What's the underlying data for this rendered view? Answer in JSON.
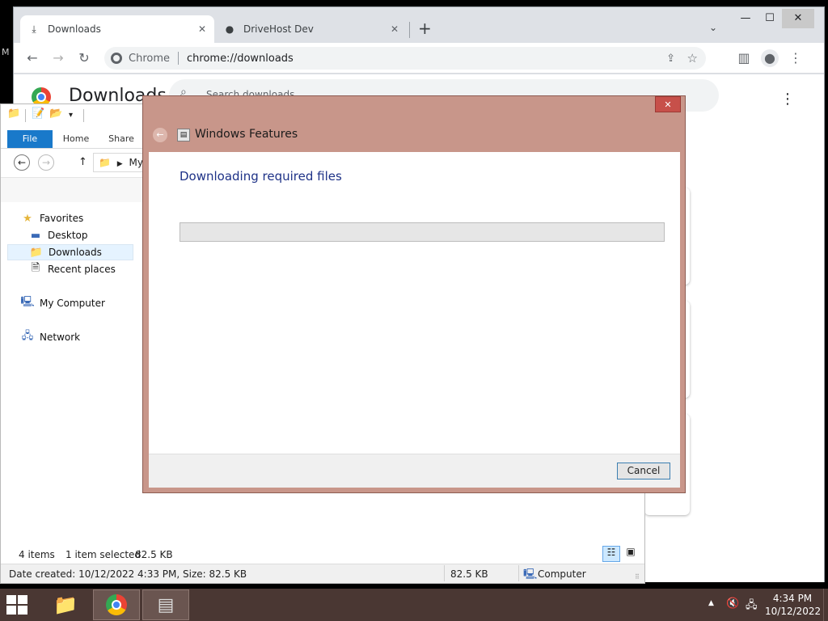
{
  "chrome": {
    "tabs": [
      {
        "label": "Downloads",
        "icon": "download-icon",
        "active": true
      },
      {
        "label": "DriveHost Dev",
        "icon": "globe-icon",
        "active": false
      }
    ],
    "omnibox": {
      "site_label": "Chrome",
      "url": "chrome://downloads"
    },
    "page_title": "Downloads",
    "search_placeholder": "Search downloads"
  },
  "explorer": {
    "ribbon_tabs": [
      "File",
      "Home",
      "Share"
    ],
    "address_crumb": "My",
    "nav": {
      "favorites": "Favorites",
      "desktop": "Desktop",
      "downloads": "Downloads",
      "recent": "Recent places",
      "computer": "My Computer",
      "network": "Network"
    },
    "status": {
      "items": "4 items",
      "selected": "1 item selected",
      "size": "82.5 KB"
    },
    "details_bar": {
      "info": "Date created: 10/12/2022 4:33 PM, Size: 82.5 KB",
      "size": "82.5 KB",
      "location": "Computer"
    }
  },
  "dialog": {
    "title": "Windows Features",
    "heading": "Downloading required files",
    "progress": 0,
    "cancel_label": "Cancel",
    "close_label": "✕"
  },
  "taskbar": {
    "time": "4:34 PM",
    "date": "10/12/2022"
  },
  "colors": {
    "dialog_frame": "#c8968a",
    "heading": "#1e3287",
    "taskbar": "#4a3733",
    "file_tab": "#1979ca"
  }
}
